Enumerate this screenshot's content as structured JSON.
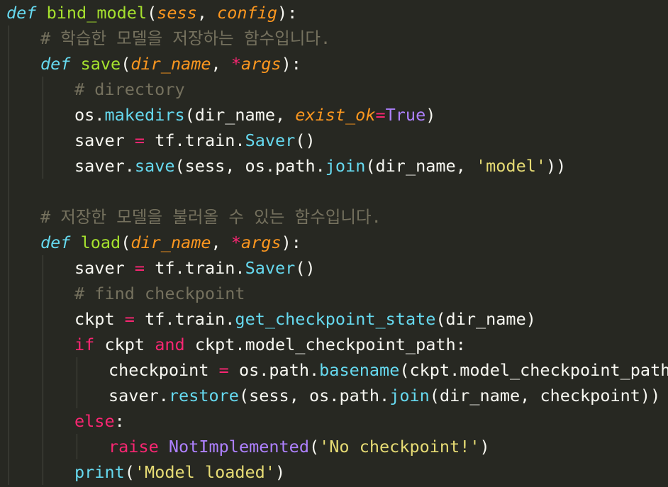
{
  "editor": {
    "theme_colors": {
      "background": "#272822",
      "default": "#f8f8f2",
      "keyword": "#f92672",
      "def_keyword": "#66d9ef",
      "function": "#a6e22e",
      "parameter": "#fd971f",
      "builtin_call": "#66d9ef",
      "constant": "#ae81ff",
      "string": "#e6db74",
      "comment": "#75715e"
    },
    "lines": [
      {
        "indent": 0,
        "tokens": [
          {
            "t": "def",
            "c": "kw-def"
          },
          {
            "t": " "
          },
          {
            "t": "bind_model",
            "c": "fn"
          },
          {
            "t": "(",
            "c": "punc"
          },
          {
            "t": "sess",
            "c": "param"
          },
          {
            "t": ", ",
            "c": "punc"
          },
          {
            "t": "config",
            "c": "param"
          },
          {
            "t": "):",
            "c": "punc"
          }
        ]
      },
      {
        "indent": 1,
        "tokens": [
          {
            "t": "# 학습한 모델을 저장하는 함수입니다.",
            "c": "comment"
          }
        ]
      },
      {
        "indent": 1,
        "tokens": [
          {
            "t": "def",
            "c": "kw-def"
          },
          {
            "t": " "
          },
          {
            "t": "save",
            "c": "fn"
          },
          {
            "t": "(",
            "c": "punc"
          },
          {
            "t": "dir_name",
            "c": "param"
          },
          {
            "t": ", ",
            "c": "punc"
          },
          {
            "t": "*",
            "c": "op"
          },
          {
            "t": "args",
            "c": "param"
          },
          {
            "t": "):",
            "c": "punc"
          }
        ]
      },
      {
        "indent": 2,
        "tokens": [
          {
            "t": "# directory",
            "c": "comment"
          }
        ]
      },
      {
        "indent": 2,
        "tokens": [
          {
            "t": "os",
            "c": "plain"
          },
          {
            "t": ".",
            "c": "punc"
          },
          {
            "t": "makedirs",
            "c": "call"
          },
          {
            "t": "(",
            "c": "punc"
          },
          {
            "t": "dir_name",
            "c": "plain"
          },
          {
            "t": ", ",
            "c": "punc"
          },
          {
            "t": "exist_ok",
            "c": "param"
          },
          {
            "t": "=",
            "c": "op"
          },
          {
            "t": "True",
            "c": "const"
          },
          {
            "t": ")",
            "c": "punc"
          }
        ]
      },
      {
        "indent": 2,
        "tokens": [
          {
            "t": "saver",
            "c": "plain"
          },
          {
            "t": " "
          },
          {
            "t": "=",
            "c": "op"
          },
          {
            "t": " "
          },
          {
            "t": "tf",
            "c": "plain"
          },
          {
            "t": ".",
            "c": "punc"
          },
          {
            "t": "train",
            "c": "plain"
          },
          {
            "t": ".",
            "c": "punc"
          },
          {
            "t": "Saver",
            "c": "cls"
          },
          {
            "t": "()",
            "c": "punc"
          }
        ]
      },
      {
        "indent": 2,
        "tokens": [
          {
            "t": "saver",
            "c": "plain"
          },
          {
            "t": ".",
            "c": "punc"
          },
          {
            "t": "save",
            "c": "call"
          },
          {
            "t": "(",
            "c": "punc"
          },
          {
            "t": "sess",
            "c": "plain"
          },
          {
            "t": ", ",
            "c": "punc"
          },
          {
            "t": "os",
            "c": "plain"
          },
          {
            "t": ".",
            "c": "punc"
          },
          {
            "t": "path",
            "c": "plain"
          },
          {
            "t": ".",
            "c": "punc"
          },
          {
            "t": "join",
            "c": "call"
          },
          {
            "t": "(",
            "c": "punc"
          },
          {
            "t": "dir_name",
            "c": "plain"
          },
          {
            "t": ", ",
            "c": "punc"
          },
          {
            "t": "'model'",
            "c": "str"
          },
          {
            "t": "))",
            "c": "punc"
          }
        ]
      },
      {
        "indent": 1,
        "tokens": []
      },
      {
        "indent": 1,
        "tokens": [
          {
            "t": "# 저장한 모델을 불러올 수 있는 함수입니다.",
            "c": "comment"
          }
        ]
      },
      {
        "indent": 1,
        "tokens": [
          {
            "t": "def",
            "c": "kw-def"
          },
          {
            "t": " "
          },
          {
            "t": "load",
            "c": "fn"
          },
          {
            "t": "(",
            "c": "punc"
          },
          {
            "t": "dir_name",
            "c": "param"
          },
          {
            "t": ", ",
            "c": "punc"
          },
          {
            "t": "*",
            "c": "op"
          },
          {
            "t": "args",
            "c": "param"
          },
          {
            "t": "):",
            "c": "punc"
          }
        ]
      },
      {
        "indent": 2,
        "tokens": [
          {
            "t": "saver",
            "c": "plain"
          },
          {
            "t": " "
          },
          {
            "t": "=",
            "c": "op"
          },
          {
            "t": " "
          },
          {
            "t": "tf",
            "c": "plain"
          },
          {
            "t": ".",
            "c": "punc"
          },
          {
            "t": "train",
            "c": "plain"
          },
          {
            "t": ".",
            "c": "punc"
          },
          {
            "t": "Saver",
            "c": "cls"
          },
          {
            "t": "()",
            "c": "punc"
          }
        ]
      },
      {
        "indent": 2,
        "tokens": [
          {
            "t": "# find checkpoint",
            "c": "comment"
          }
        ]
      },
      {
        "indent": 2,
        "tokens": [
          {
            "t": "ckpt",
            "c": "plain"
          },
          {
            "t": " "
          },
          {
            "t": "=",
            "c": "op"
          },
          {
            "t": " "
          },
          {
            "t": "tf",
            "c": "plain"
          },
          {
            "t": ".",
            "c": "punc"
          },
          {
            "t": "train",
            "c": "plain"
          },
          {
            "t": ".",
            "c": "punc"
          },
          {
            "t": "get_checkpoint_state",
            "c": "call"
          },
          {
            "t": "(",
            "c": "punc"
          },
          {
            "t": "dir_name",
            "c": "plain"
          },
          {
            "t": ")",
            "c": "punc"
          }
        ]
      },
      {
        "indent": 2,
        "tokens": [
          {
            "t": "if",
            "c": "kw"
          },
          {
            "t": " "
          },
          {
            "t": "ckpt",
            "c": "plain"
          },
          {
            "t": " "
          },
          {
            "t": "and",
            "c": "kw"
          },
          {
            "t": " "
          },
          {
            "t": "ckpt",
            "c": "plain"
          },
          {
            "t": ".",
            "c": "punc"
          },
          {
            "t": "model_checkpoint_path",
            "c": "plain"
          },
          {
            "t": ":",
            "c": "punc"
          }
        ]
      },
      {
        "indent": 3,
        "tokens": [
          {
            "t": "checkpoint",
            "c": "plain"
          },
          {
            "t": " "
          },
          {
            "t": "=",
            "c": "op"
          },
          {
            "t": " "
          },
          {
            "t": "os",
            "c": "plain"
          },
          {
            "t": ".",
            "c": "punc"
          },
          {
            "t": "path",
            "c": "plain"
          },
          {
            "t": ".",
            "c": "punc"
          },
          {
            "t": "basename",
            "c": "call"
          },
          {
            "t": "(",
            "c": "punc"
          },
          {
            "t": "ckpt",
            "c": "plain"
          },
          {
            "t": ".",
            "c": "punc"
          },
          {
            "t": "model_checkpoint_path",
            "c": "plain"
          },
          {
            "t": ")",
            "c": "punc"
          }
        ]
      },
      {
        "indent": 3,
        "tokens": [
          {
            "t": "saver",
            "c": "plain"
          },
          {
            "t": ".",
            "c": "punc"
          },
          {
            "t": "restore",
            "c": "call"
          },
          {
            "t": "(",
            "c": "punc"
          },
          {
            "t": "sess",
            "c": "plain"
          },
          {
            "t": ", ",
            "c": "punc"
          },
          {
            "t": "os",
            "c": "plain"
          },
          {
            "t": ".",
            "c": "punc"
          },
          {
            "t": "path",
            "c": "plain"
          },
          {
            "t": ".",
            "c": "punc"
          },
          {
            "t": "join",
            "c": "call"
          },
          {
            "t": "(",
            "c": "punc"
          },
          {
            "t": "dir_name",
            "c": "plain"
          },
          {
            "t": ", ",
            "c": "punc"
          },
          {
            "t": "checkpoint",
            "c": "plain"
          },
          {
            "t": "))",
            "c": "punc"
          }
        ]
      },
      {
        "indent": 2,
        "tokens": [
          {
            "t": "else",
            "c": "kw"
          },
          {
            "t": ":",
            "c": "punc"
          }
        ]
      },
      {
        "indent": 3,
        "tokens": [
          {
            "t": "raise",
            "c": "kw"
          },
          {
            "t": " "
          },
          {
            "t": "NotImplemented",
            "c": "const"
          },
          {
            "t": "(",
            "c": "punc"
          },
          {
            "t": "'No checkpoint!'",
            "c": "str"
          },
          {
            "t": ")",
            "c": "punc"
          }
        ]
      },
      {
        "indent": 2,
        "tokens": [
          {
            "t": "print",
            "c": "call"
          },
          {
            "t": "(",
            "c": "punc"
          },
          {
            "t": "'Model loaded'",
            "c": "str"
          },
          {
            "t": ")",
            "c": "punc"
          }
        ]
      }
    ]
  }
}
